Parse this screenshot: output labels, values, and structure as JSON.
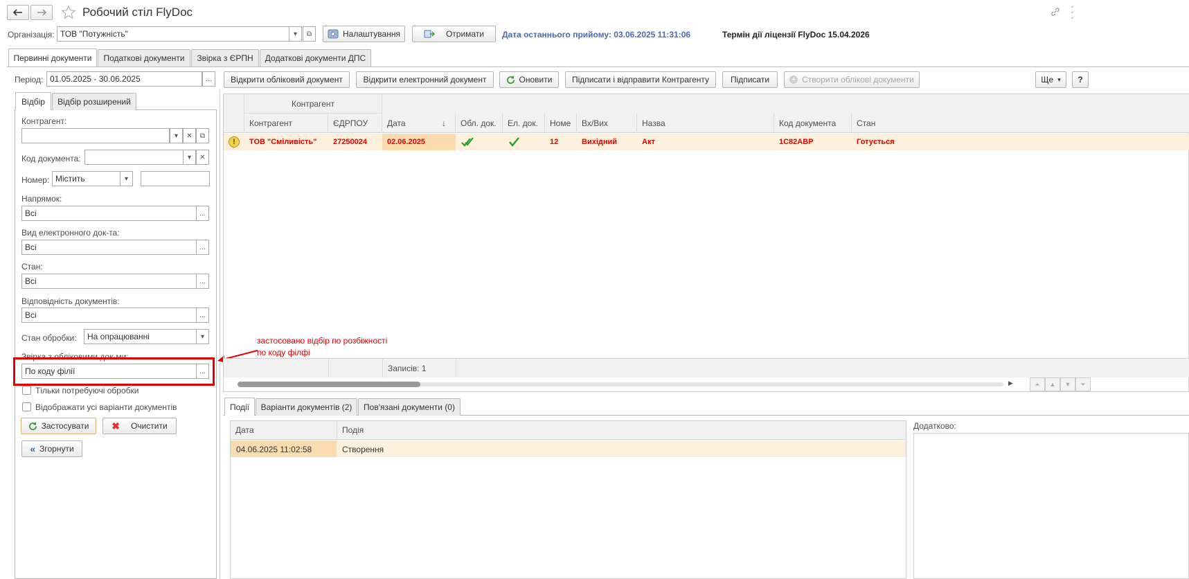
{
  "window": {
    "title": "Робочий стіл FlyDoc",
    "back_icon": "arrow-left-icon",
    "forward_icon": "arrow-right-icon",
    "star_icon": "star-icon",
    "link_icon": "link-icon",
    "menu_icon": "more-vert-icon"
  },
  "header": {
    "org_label": "Організація:",
    "org_value": "ТОВ \"Потужність\"",
    "settings_label": "Налаштування",
    "receive_label": "Отримати",
    "last_receive": "Дата останнього прийому: 03.06.2025 11:31:06",
    "license": "Термін дії ліцензії FlyDoc 15.04.2026"
  },
  "main_tabs": [
    "Первинні документи",
    "Податкові документи",
    "Звірка з ЄРПН",
    "Додаткові документи ДПС"
  ],
  "filter": {
    "period_label": "Період:",
    "period_value": "01.05.2025 - 30.06.2025",
    "subtabs": [
      "Відбір",
      "Відбір розширений"
    ],
    "counterparty_label": "Контрагент:",
    "counterparty_value": "",
    "doc_code_label": "Код документа:",
    "doc_code_value": "",
    "number_label": "Номер:",
    "number_mode": "Містить",
    "number_value": "",
    "direction_label": "Напрямок:",
    "direction_value": "Всі",
    "edoc_type_label": "Вид електронного док-та:",
    "edoc_type_value": "Всі",
    "state_label": "Стан:",
    "state_value": "Всі",
    "match_label": "Відповідність документів:",
    "match_value": "Всі",
    "processing_label": "Стан обробки:",
    "processing_value": "На опрацюванні",
    "reconcile_label": "Звірка з обліковими док-ми:",
    "reconcile_value": "По коду філії",
    "only_need_label": "Тільки потребуючі обробки",
    "show_all_label": "Відображати усі варіанти документів",
    "apply_label": "Застосувати",
    "clear_label": "Очистити",
    "collapse_label": "Згорнути"
  },
  "annotation": {
    "text_line1": "застосовано відбір по розбіжності",
    "text_line2": "по коду філфі",
    "color": "#e60000"
  },
  "toolbar": {
    "open_account_doc": "Відкрити обліковий документ",
    "open_edoc": "Відкрити електронний документ",
    "refresh": "Оновити",
    "sign_send": "Підписати і відправити Контрагенту",
    "sign": "Підписати",
    "create_docs": "Створити облікові документи",
    "more": "Ще",
    "help": "?"
  },
  "grid": {
    "group_header": "Контрагент",
    "columns": [
      "Контрагент",
      "ЄДРПОУ",
      "Дата",
      "Обл. док.",
      "Ел. док.",
      "Номе",
      "Вх/Вих",
      "Назва",
      "Код документа",
      "Стан"
    ],
    "rows": [
      {
        "counterparty": "ТОВ \"Сміливість\"",
        "edrpou": "27250024",
        "date": "02.06.2025",
        "acc_doc_icon": "double-check-icon",
        "edoc_icon": "check-icon",
        "number": "12",
        "direction": "Вихідний",
        "name": "Акт",
        "code": "1С82АВР",
        "state": "Готується"
      }
    ],
    "records": "Записів: 1"
  },
  "bottom_tabs": [
    "Події",
    "Варіанти документів (2)",
    "Пов'язані документи (0)"
  ],
  "events": {
    "columns": [
      "Дата",
      "Подія"
    ],
    "rows": [
      {
        "date": "04.06.2025 11:02:58",
        "event": "Створення"
      }
    ],
    "extra_label": "Додатково:"
  },
  "colors": {
    "row_highlight": "#fdf0dc",
    "accent_blue": "#4a6ab5",
    "red": "#e60000"
  }
}
